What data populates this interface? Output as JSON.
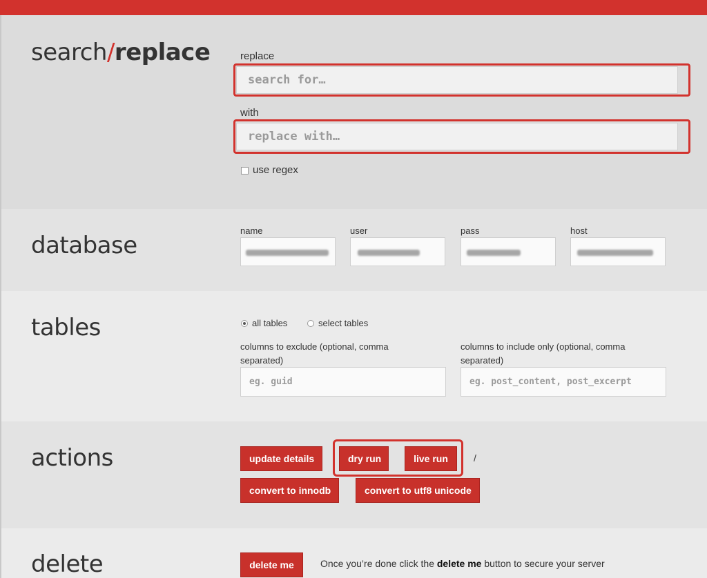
{
  "search_replace": {
    "heading_search": "search",
    "heading_slash": "/",
    "heading_replace": "replace",
    "replace_label": "replace",
    "search_placeholder": "search for…",
    "with_label": "with",
    "replace_placeholder": "replace with…",
    "use_regex_label": "use regex",
    "use_regex_checked": false
  },
  "database": {
    "heading": "database",
    "fields": [
      {
        "label": "name",
        "value": ""
      },
      {
        "label": "user",
        "value": ""
      },
      {
        "label": "pass",
        "value": ""
      },
      {
        "label": "host",
        "value": ""
      }
    ]
  },
  "tables": {
    "heading": "tables",
    "all_tables_label": "all tables",
    "select_tables_label": "select tables",
    "selected": "all tables",
    "exclude_label_1": "columns to exclude (optional, comma",
    "exclude_label_2": "separated)",
    "exclude_placeholder": "eg. guid",
    "include_label_1": "columns to include only (optional, comma",
    "include_label_2": "separated)",
    "include_placeholder": "eg. post_content, post_excerpt"
  },
  "actions": {
    "heading": "actions",
    "update_details": "update details",
    "dry_run": "dry run",
    "live_run": "live run",
    "separator": "/",
    "convert_innodb": "convert to innodb",
    "convert_utf8": "convert to utf8 unicode"
  },
  "delete": {
    "heading": "delete",
    "delete_me": "delete me",
    "text_before": "Once you’re done click the ",
    "text_bold": "delete me",
    "text_after": " button to secure your server"
  },
  "colors": {
    "accent": "#d2322d",
    "button_bg": "#c8312b"
  }
}
